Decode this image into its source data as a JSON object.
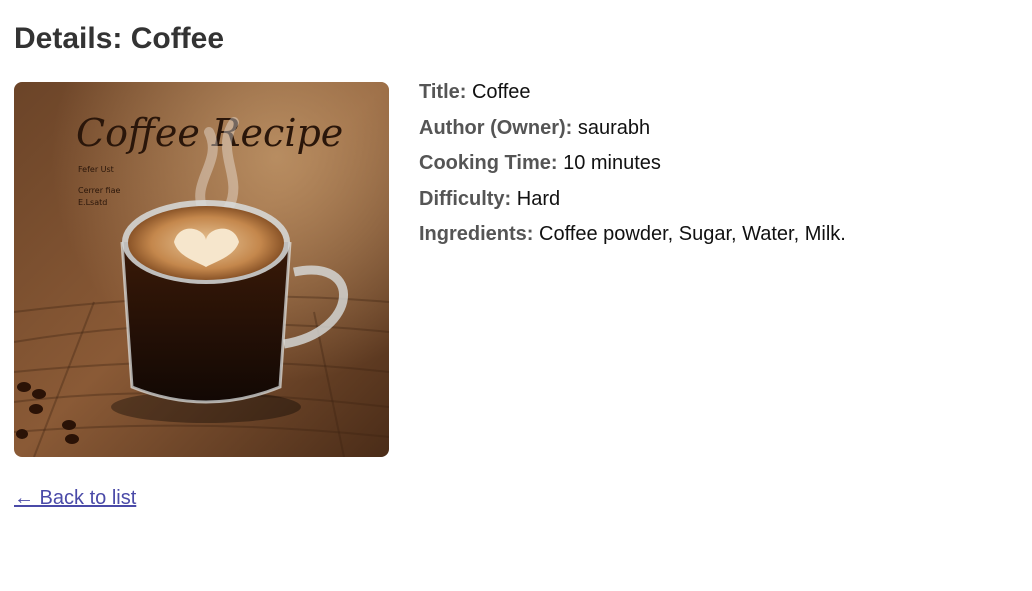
{
  "page": {
    "heading": "Details: Coffee",
    "back_link": "← Back to list"
  },
  "image": {
    "alt": "Coffee",
    "overlay_title": "Coffee Recipe",
    "overlay_items": [
      "Fefer Ust",
      "Cerrer fiae",
      "E.Lsatd"
    ]
  },
  "details": [
    {
      "label": "Title:",
      "value": "Coffee"
    },
    {
      "label": "Author (Owner):",
      "value": "saurabh"
    },
    {
      "label": "Cooking Time:",
      "value": "10 minutes"
    },
    {
      "label": "Difficulty:",
      "value": "Hard"
    },
    {
      "label": "Ingredients:",
      "value": "Coffee powder, Sugar, Water, Milk."
    }
  ],
  "colors": {
    "link": "#4a4aa8",
    "label": "#555555",
    "heading": "#333333"
  }
}
